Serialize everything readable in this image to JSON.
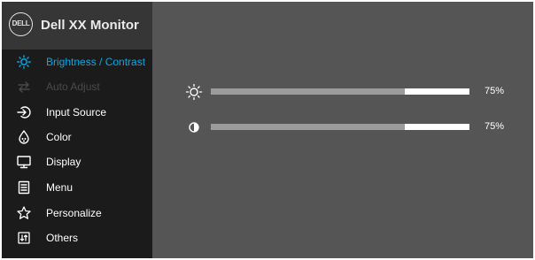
{
  "header": {
    "logo_text": "DELL",
    "title": "Dell XX Monitor"
  },
  "sidebar": {
    "items": [
      {
        "label": "Brightness / Contrast",
        "icon": "brightness-icon",
        "state": "active"
      },
      {
        "label": "Auto Adjust",
        "icon": "auto-adjust-icon",
        "state": "disabled"
      },
      {
        "label": "Input Source",
        "icon": "input-source-icon",
        "state": "normal"
      },
      {
        "label": "Color",
        "icon": "color-palette-icon",
        "state": "normal"
      },
      {
        "label": "Display",
        "icon": "display-icon",
        "state": "normal"
      },
      {
        "label": "Menu",
        "icon": "menu-icon",
        "state": "normal"
      },
      {
        "label": "Personalize",
        "icon": "star-icon",
        "state": "normal"
      },
      {
        "label": "Others",
        "icon": "others-icon",
        "state": "normal"
      }
    ]
  },
  "main": {
    "brightness": {
      "icon": "sun-icon",
      "value": 75,
      "value_text": "75%"
    },
    "contrast": {
      "icon": "contrast-icon",
      "value": 75,
      "value_text": "75%"
    }
  },
  "colors": {
    "active": "#00a9e8",
    "disabled": "#4a4a4a",
    "sidebar_bg": "#1b1b1b",
    "header_bg": "#363636",
    "panel_bg": "#555555",
    "slider_fill": "#9b9b9b",
    "slider_track": "#ffffff"
  }
}
